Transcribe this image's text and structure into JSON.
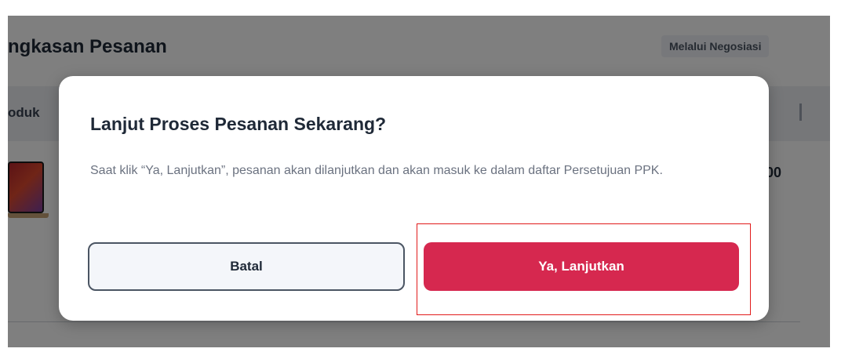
{
  "background_page": {
    "summary_title": "ngkasan Pesanan",
    "badge": "Melalui Negosiasi",
    "table_header_label": "oduk",
    "price_fragment": "00"
  },
  "modal": {
    "title": "Lanjut Proses Pesanan Sekarang?",
    "description": "Saat klik “Ya, Lanjutkan”, pesanan akan dilanjutkan dan akan masuk ke dalam daftar Persetujuan PPK.",
    "cancel_label": "Batal",
    "confirm_label": "Ya, Lanjutkan"
  },
  "colors": {
    "confirm_button": "#d6284f",
    "highlight": "#e11b1b",
    "overlay": "rgba(0,0,0,0.5)"
  },
  "icons": {
    "product_thumbnail": "laptop-thumbnail"
  }
}
